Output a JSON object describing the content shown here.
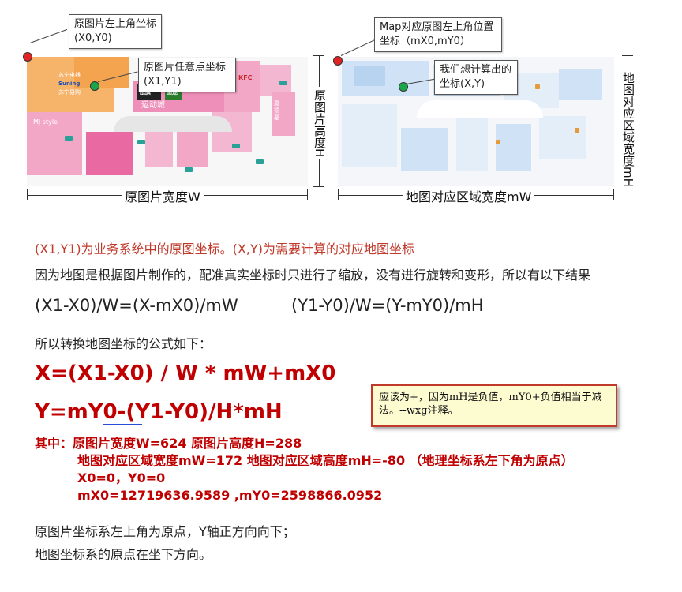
{
  "left_figure": {
    "callout_origin": "原图片左上角坐标(X0,Y0)",
    "callout_point": "原图片任意点坐标(X1,Y1)",
    "width_label": "原图片宽度W",
    "height_label": "原图片高度H",
    "store_labels": {
      "suning1": "苏宁电器",
      "suning2": "Suning",
      "suning3": "苏宁易购",
      "zhanqi": "战旗",
      "tuyuan": "图途",
      "yundong": "运动城",
      "kfc": "KFC",
      "mj": "MJ style",
      "block": "嘉德基"
    }
  },
  "right_figure": {
    "callout_origin": "Map对应原图左上角位置坐标（mX0,mY0）",
    "callout_point": "我们想计算出的坐标(X,Y)",
    "width_label": "地图对应区域宽度mW",
    "height_label": "地图对应区域宽度mH"
  },
  "text": {
    "line1": "(X1,Y1)为业务系统中的原图坐标。(X,Y)为需要计算的对应地图坐标",
    "line2": "因为地图是根据图片制作的，配准真实坐标时只进行了缩放，没有进行旋转和变形，所以有以下结果",
    "eq1": "(X1-X0)/W=(X-mX0)/mW",
    "eq2": "(Y1-Y0)/W=(Y-mY0)/mH",
    "line3": "所以转换地图坐标的公式如下：",
    "formula_x": "X=(X1-X0) / W * mW+mX0",
    "formula_y": "Y=mY0-(Y1-Y0)/H*mH",
    "note": "应该为+，因为mH是负值，mY0+负值相当于减法。--wxg注释。",
    "param1": "其中：原图片宽度W=624  原图片高度H=288",
    "param2": "地图对应区域宽度mW=172 地图对应区域高度mH=-80 （地理坐标系左下角为原点）",
    "param3": "X0=0，Y0=0",
    "param4": "mX0=12719636.9589 ,mY0=2598866.0952",
    "line4": "原图片坐标系左上角为原点，Y轴正方向向下；",
    "line5": "地图坐标系的原点在坐下方向。"
  },
  "colors": {
    "formula": "#c00000",
    "note_border": "#c0392b",
    "note_bg": "#fdfbd0",
    "origin_dot": "#e02424",
    "point_dot": "#1aa64a"
  }
}
